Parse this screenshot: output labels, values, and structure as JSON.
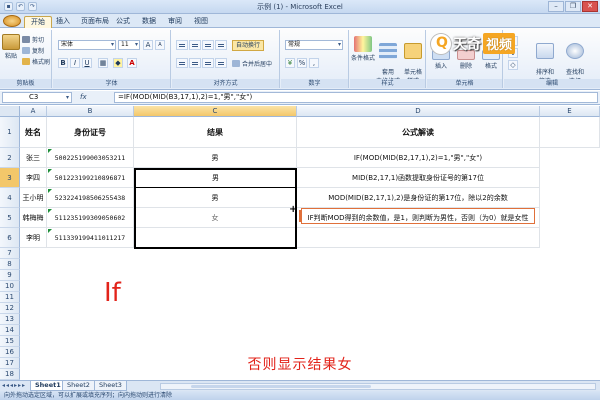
{
  "window": {
    "title": "示例 (1) - Microsoft Excel",
    "qat": [
      "▪",
      "↶",
      "↷"
    ],
    "controls": [
      "–",
      "❐",
      "✕"
    ]
  },
  "tabs": [
    "开始",
    "插入",
    "页面布局",
    "公式",
    "数据",
    "审阅",
    "视图"
  ],
  "ribbon": {
    "clipboard": {
      "paste": "粘贴",
      "cut": "剪切",
      "copy": "复制",
      "format_painter": "格式刷",
      "name": "剪贴板"
    },
    "font": {
      "font_name": "宋体",
      "font_size": "11",
      "bold": "B",
      "italic": "I",
      "underline": "U",
      "grow": "A",
      "shrink": "A",
      "name": "字体"
    },
    "alignment": {
      "wrap": "自动换行",
      "merge": "合并后居中",
      "name": "对齐方式"
    },
    "number": {
      "format": "常规",
      "percent": "%",
      "comma": ",",
      "name": "数字"
    },
    "styles": {
      "conditional": "条件格式",
      "table_format": "套用\n表格格式",
      "cell_styles": "单元格\n样式",
      "name": "样式"
    },
    "cells": {
      "insert": "插入",
      "delete": "删除",
      "format": "格式",
      "name": "单元格"
    },
    "editing": {
      "sort_filter": "排序和\n筛选",
      "find_select": "查找和\n选择",
      "name": "编辑"
    }
  },
  "watermark": {
    "brand_a": "天奇",
    "brand_b": "视频"
  },
  "formula_bar": {
    "name_box": "C3",
    "fx": "fx",
    "formula": "=IF(MOD(MID(B3,17,1),2)=1,\"男\",\"女\")"
  },
  "columns": [
    "A",
    "B",
    "C",
    "D",
    "E"
  ],
  "rows": [
    "1",
    "2",
    "3",
    "4",
    "5",
    "6",
    "7",
    "8",
    "9",
    "10",
    "11",
    "12",
    "13",
    "14",
    "15",
    "16",
    "17",
    "18"
  ],
  "table": {
    "headers": [
      "姓名",
      "身份证号",
      "结果",
      "公式解读"
    ],
    "data": [
      [
        "张三",
        "500225199003053211",
        "男",
        "IF(MOD(MID(B2,17,1),2)=1,\"男\",\"女\")"
      ],
      [
        "李四",
        "501223199210896871",
        "男",
        "MID(B2,17,1)函数提取身份证号的第17位"
      ],
      [
        "王小明",
        "523224198506255438",
        "男",
        "MOD(MID(B2,17,1),2)是身份证的第17位，除以2的余数"
      ],
      [
        "韩梅梅",
        "511235199309050602",
        "女",
        "IF判断MOD得到的余数值，是1，则判断为男性，否则（为0）就是女性"
      ],
      [
        "李明",
        "511339199411011217",
        "",
        ""
      ]
    ]
  },
  "overlay": {
    "big": "If",
    "subtitle": "否则显示结果女"
  },
  "sheets": {
    "nav": "◂◂◂▸▸▸",
    "tabs": [
      "Sheet1",
      "Sheet2",
      "Sheet3"
    ]
  },
  "status": "向外拖动选定区域，可以扩展或填充序列；向内拖动则进行清除"
}
